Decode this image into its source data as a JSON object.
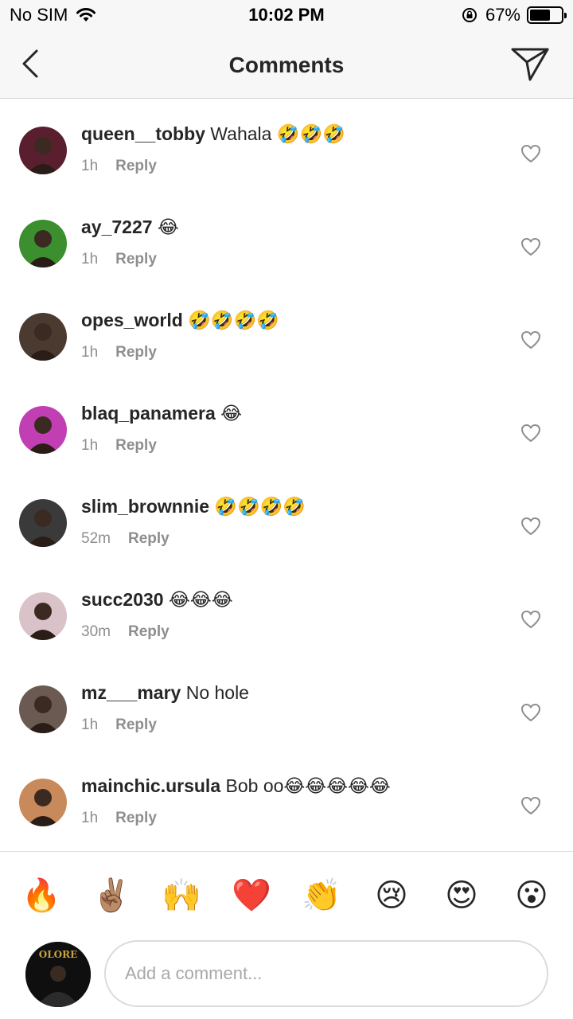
{
  "status_bar": {
    "carrier": "No SIM",
    "time": "10:02 PM",
    "battery_text": "67%",
    "battery_level": 0.67
  },
  "header": {
    "title": "Comments",
    "back_icon": "chevron-left-icon",
    "send_icon": "paper-plane-icon"
  },
  "comments": [
    {
      "username": "queen__tobby",
      "text": " Wahala 🤣🤣🤣",
      "time": "1h",
      "reply": "Reply",
      "avatar_color": "#5a1f2e"
    },
    {
      "username": "ay_7227",
      "text": " 😂",
      "time": "1h",
      "reply": "Reply",
      "avatar_color": "#3b8f2e"
    },
    {
      "username": "opes_world",
      "text": " 🤣🤣🤣🤣",
      "time": "1h",
      "reply": "Reply",
      "avatar_color": "#4a3a30"
    },
    {
      "username": "blaq_panamera",
      "text": " 😂",
      "time": "1h",
      "reply": "Reply",
      "avatar_color": "#c23fb3"
    },
    {
      "username": "slim_brownnie",
      "text": " 🤣🤣🤣🤣",
      "time": "52m",
      "reply": "Reply",
      "avatar_color": "#3a3a3a"
    },
    {
      "username": "succ2030",
      "text": " 😂😂😂",
      "time": "30m",
      "reply": "Reply",
      "avatar_color": "#d9c2c8"
    },
    {
      "username": "mz___mary",
      "text": " No hole",
      "time": "1h",
      "reply": "Reply",
      "avatar_color": "#6b5a52"
    },
    {
      "username": "mainchic.ursula",
      "text": " Bob oo😂😂😂😂😂",
      "time": "1h",
      "reply": "Reply",
      "avatar_color": "#c88a5a"
    }
  ],
  "emoji_bar": [
    "🔥",
    "✌🏽",
    "🙌",
    "❤️",
    "👏",
    "😢",
    "😍",
    "😮"
  ],
  "composer": {
    "placeholder": "Add a comment...",
    "avatar_text": "OLORE"
  },
  "colors": {
    "text": "#262626",
    "meta": "#8e8e8e",
    "divider": "#dbdbdb",
    "header_bg": "#f7f7f7"
  }
}
